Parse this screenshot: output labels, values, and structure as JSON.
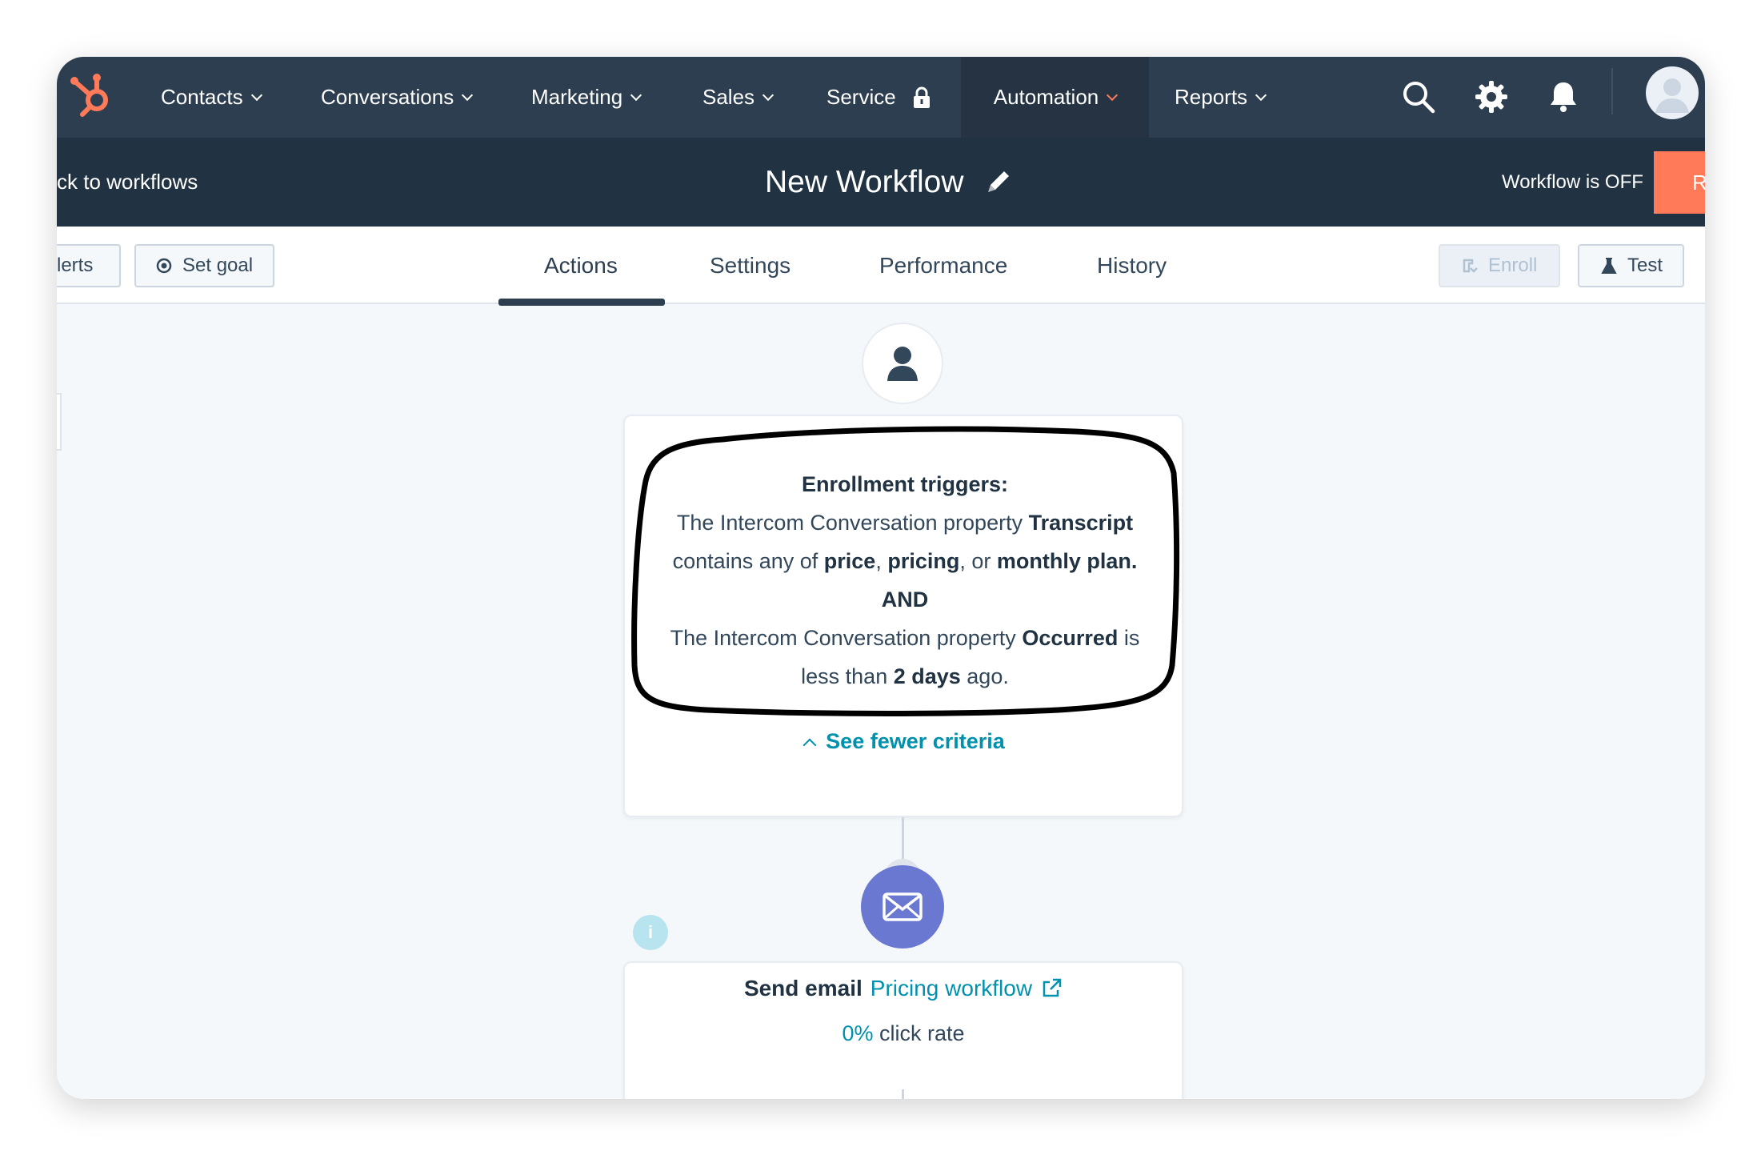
{
  "nav": {
    "items": [
      {
        "label": "Contacts"
      },
      {
        "label": "Conversations"
      },
      {
        "label": "Marketing"
      },
      {
        "label": "Sales"
      },
      {
        "label": "Service"
      },
      {
        "label": "Automation"
      },
      {
        "label": "Reports"
      }
    ],
    "active_item": "Automation",
    "accent_color": "#ff7a59",
    "bg_color": "#2d3e50",
    "icons": [
      "hubspot-logo-icon",
      "search-icon",
      "gear-icon",
      "bell-icon",
      "avatar"
    ]
  },
  "workflow_header": {
    "back_label": "ck to workflows",
    "title": "New Workflow",
    "status": "Workflow is OFF",
    "review_label": "R"
  },
  "toolbar": {
    "alerts_label": "lerts",
    "set_goal_label": "Set goal",
    "tabs": [
      "Actions",
      "Settings",
      "Performance",
      "History"
    ],
    "active_tab": "Actions",
    "enroll_label": "Enroll",
    "test_label": "Test"
  },
  "trigger": {
    "heading": "Enrollment triggers:",
    "line1_pre": "The Intercom Conversation property ",
    "line1_bold": "Transcript",
    "line2_pre": "contains any of ",
    "line2_b1": "price",
    "line2_sep1": ", ",
    "line2_b2": "pricing",
    "line2_sep2": ", or ",
    "line2_b3": "monthly plan.",
    "and": "AND",
    "line3_pre": "The Intercom Conversation property ",
    "line3_bold": "Occurred",
    "line3_post": " is",
    "line4_pre": "less than ",
    "line4_bold": "2 days",
    "line4_post": " ago.",
    "see_fewer": "See fewer criteria"
  },
  "action": {
    "label": "Send email",
    "link": "Pricing workflow",
    "rate_value": "0%",
    "rate_label": " click rate"
  }
}
